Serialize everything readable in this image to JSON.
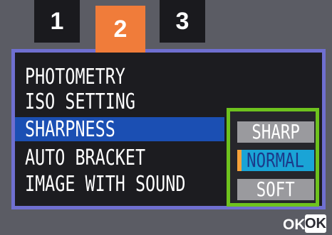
{
  "tabs": [
    {
      "label": "1"
    },
    {
      "label": "2"
    },
    {
      "label": "3"
    }
  ],
  "menu": {
    "items": [
      {
        "label": "PHOTOMETRY"
      },
      {
        "label": "ISO SETTING"
      },
      {
        "label": "SHARPNESS"
      },
      {
        "label": "AUTO BRACKET"
      },
      {
        "label": "IMAGE WITH SOUND"
      }
    ],
    "selected": "SHARPNESS"
  },
  "options": {
    "items": [
      {
        "label": "SHARP"
      },
      {
        "label": "NORMAL"
      },
      {
        "label": "SOFT"
      }
    ],
    "selected": "NORMAL"
  },
  "footer": {
    "ok_text": "OK",
    "ok_badge": "OK"
  },
  "colors": {
    "active_tab": "#f07c3a",
    "panel_border": "#6f6fd0",
    "highlight": "#1b4fb3",
    "options_border": "#6ec21e",
    "selected_option": "#1aa4d6"
  }
}
